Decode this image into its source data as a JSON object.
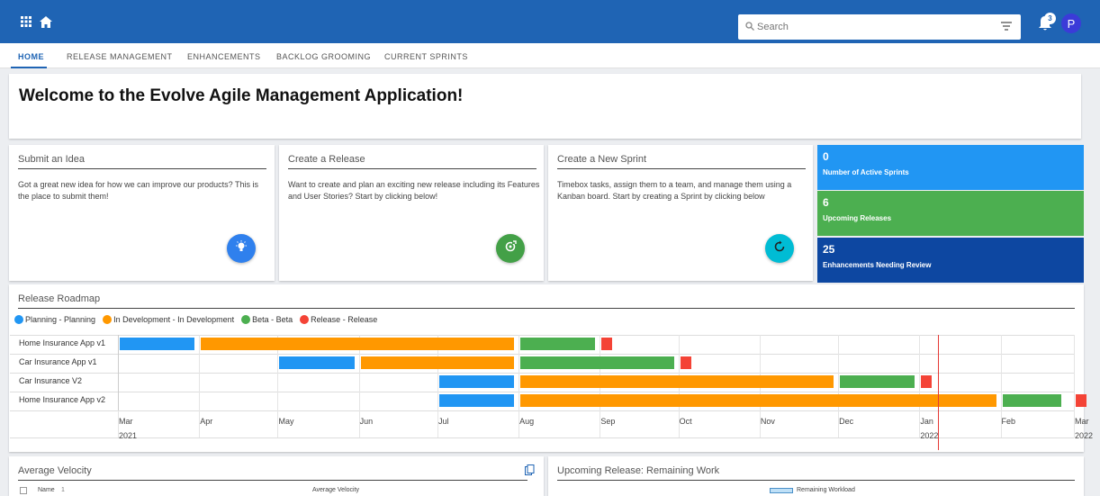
{
  "topbar": {
    "search_placeholder": "Search",
    "notifications": "3",
    "avatar": "P"
  },
  "tabs": [
    "HOME",
    "RELEASE MANAGEMENT",
    "ENHANCEMENTS",
    "BACKLOG GROOMING",
    "CURRENT SPRINTS"
  ],
  "welcome": "Welcome to the Evolve Agile Management Application!",
  "cards": [
    {
      "title": "Submit an Idea",
      "desc": "Got a great new idea for how we can improve our products? This is the place to submit them!"
    },
    {
      "title": "Create a Release",
      "desc": "Want to create and plan an exciting new release including its Features and User Stories? Start by clicking below!"
    },
    {
      "title": "Create a New Sprint",
      "desc": "Timebox tasks, assign them to a team, and manage them using a Kanban board. Start by creating a Sprint by clicking below"
    }
  ],
  "stats": [
    {
      "value": "0",
      "label": "Number of Active Sprints",
      "color": "#2196f3"
    },
    {
      "value": "6",
      "label": "Upcoming Releases",
      "color": "#4caf50"
    },
    {
      "value": "25",
      "label": "Enhancements Needing Review",
      "color": "#0d47a1"
    }
  ],
  "roadmap": {
    "title": "Release Roadmap",
    "legend": [
      {
        "label": "Planning - Planning",
        "color": "#2196f3"
      },
      {
        "label": "In Development - In Development",
        "color": "#ff9800"
      },
      {
        "label": "Beta - Beta",
        "color": "#4caf50"
      },
      {
        "label": "Release - Release",
        "color": "#f44336"
      }
    ],
    "months": [
      "Mar",
      "Apr",
      "May",
      "Jun",
      "Jul",
      "Aug",
      "Sep",
      "Oct",
      "Nov",
      "Dec",
      "Jan",
      "Feb",
      "Mar"
    ],
    "years": [
      "2021",
      "2022"
    ]
  },
  "chart_data": {
    "type": "gantt",
    "title": "Release Roadmap",
    "x_axis": {
      "start": "2021-03-01",
      "end": "2022-03-01",
      "ticks": [
        "Mar",
        "Apr",
        "May",
        "Jun",
        "Jul",
        "Aug",
        "Sep",
        "Oct",
        "Nov",
        "Dec",
        "Jan",
        "Feb",
        "Mar"
      ],
      "years": [
        "2021",
        "2022"
      ]
    },
    "today_marker": "2022-01-08",
    "rows": [
      {
        "name": "Home Insurance App v1",
        "bars": [
          {
            "phase": "Planning",
            "start": "2021-03-01",
            "end": "2021-03-31"
          },
          {
            "phase": "In Development",
            "start": "2021-04-01",
            "end": "2021-07-31"
          },
          {
            "phase": "Beta",
            "start": "2021-08-01",
            "end": "2021-08-31"
          },
          {
            "phase": "Release",
            "start": "2021-09-01",
            "end": "2021-09-05"
          }
        ]
      },
      {
        "name": "Car Insurance App v1",
        "bars": [
          {
            "phase": "Planning",
            "start": "2021-05-01",
            "end": "2021-05-31"
          },
          {
            "phase": "In Development",
            "start": "2021-06-01",
            "end": "2021-07-31"
          },
          {
            "phase": "Beta",
            "start": "2021-08-01",
            "end": "2021-09-30"
          },
          {
            "phase": "Release",
            "start": "2021-10-01",
            "end": "2021-10-05"
          }
        ]
      },
      {
        "name": "Car Insurance V2",
        "bars": [
          {
            "phase": "Planning",
            "start": "2021-07-01",
            "end": "2021-07-31"
          },
          {
            "phase": "In Development",
            "start": "2021-08-01",
            "end": "2021-11-30"
          },
          {
            "phase": "Beta",
            "start": "2021-12-01",
            "end": "2021-12-31"
          },
          {
            "phase": "Release",
            "start": "2022-01-01",
            "end": "2022-01-05"
          }
        ]
      },
      {
        "name": "Home Insurance App v2",
        "bars": [
          {
            "phase": "Planning",
            "start": "2021-07-01",
            "end": "2021-07-31"
          },
          {
            "phase": "In Development",
            "start": "2021-08-01",
            "end": "2022-01-31"
          },
          {
            "phase": "Beta",
            "start": "2022-02-01",
            "end": "2022-02-25"
          },
          {
            "phase": "Release",
            "start": "2022-03-01",
            "end": "2022-03-05"
          }
        ]
      }
    ]
  },
  "velocity": {
    "title": "Average Velocity",
    "col_name": "Name",
    "sort_badge": "1",
    "col_velocity": "Average Velocity"
  },
  "upcoming": {
    "title": "Upcoming Release: Remaining Work",
    "legend": "Remaining Workload"
  }
}
